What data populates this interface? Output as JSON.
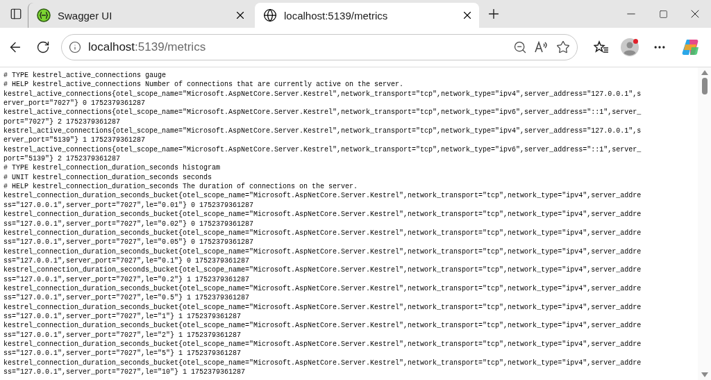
{
  "tabs": [
    {
      "title": "Swagger UI",
      "selected": false
    },
    {
      "title": "localhost:5139/metrics",
      "selected": true
    }
  ],
  "address": {
    "host": "localhost",
    "path": ":5139/metrics"
  },
  "profile": {
    "notification": true
  },
  "lines": [
    "# TYPE kestrel_active_connections gauge",
    "# HELP kestrel_active_connections Number of connections that are currently active on the server.",
    "kestrel_active_connections{otel_scope_name=\"Microsoft.AspNetCore.Server.Kestrel\",network_transport=\"tcp\",network_type=\"ipv4\",server_address=\"127.0.0.1\",s",
    "erver_port=\"7027\"} 0 1752379361287",
    "kestrel_active_connections{otel_scope_name=\"Microsoft.AspNetCore.Server.Kestrel\",network_transport=\"tcp\",network_type=\"ipv6\",server_address=\"::1\",server_",
    "port=\"7027\"} 2 1752379361287",
    "kestrel_active_connections{otel_scope_name=\"Microsoft.AspNetCore.Server.Kestrel\",network_transport=\"tcp\",network_type=\"ipv4\",server_address=\"127.0.0.1\",s",
    "erver_port=\"5139\"} 1 1752379361287",
    "kestrel_active_connections{otel_scope_name=\"Microsoft.AspNetCore.Server.Kestrel\",network_transport=\"tcp\",network_type=\"ipv6\",server_address=\"::1\",server_",
    "port=\"5139\"} 2 1752379361287",
    "# TYPE kestrel_connection_duration_seconds histogram",
    "# UNIT kestrel_connection_duration_seconds seconds",
    "# HELP kestrel_connection_duration_seconds The duration of connections on the server.",
    "kestrel_connection_duration_seconds_bucket{otel_scope_name=\"Microsoft.AspNetCore.Server.Kestrel\",network_transport=\"tcp\",network_type=\"ipv4\",server_addre",
    "ss=\"127.0.0.1\",server_port=\"7027\",le=\"0.01\"} 0 1752379361287",
    "kestrel_connection_duration_seconds_bucket{otel_scope_name=\"Microsoft.AspNetCore.Server.Kestrel\",network_transport=\"tcp\",network_type=\"ipv4\",server_addre",
    "ss=\"127.0.0.1\",server_port=\"7027\",le=\"0.02\"} 0 1752379361287",
    "kestrel_connection_duration_seconds_bucket{otel_scope_name=\"Microsoft.AspNetCore.Server.Kestrel\",network_transport=\"tcp\",network_type=\"ipv4\",server_addre",
    "ss=\"127.0.0.1\",server_port=\"7027\",le=\"0.05\"} 0 1752379361287",
    "kestrel_connection_duration_seconds_bucket{otel_scope_name=\"Microsoft.AspNetCore.Server.Kestrel\",network_transport=\"tcp\",network_type=\"ipv4\",server_addre",
    "ss=\"127.0.0.1\",server_port=\"7027\",le=\"0.1\"} 0 1752379361287",
    "kestrel_connection_duration_seconds_bucket{otel_scope_name=\"Microsoft.AspNetCore.Server.Kestrel\",network_transport=\"tcp\",network_type=\"ipv4\",server_addre",
    "ss=\"127.0.0.1\",server_port=\"7027\",le=\"0.2\"} 1 1752379361287",
    "kestrel_connection_duration_seconds_bucket{otel_scope_name=\"Microsoft.AspNetCore.Server.Kestrel\",network_transport=\"tcp\",network_type=\"ipv4\",server_addre",
    "ss=\"127.0.0.1\",server_port=\"7027\",le=\"0.5\"} 1 1752379361287",
    "kestrel_connection_duration_seconds_bucket{otel_scope_name=\"Microsoft.AspNetCore.Server.Kestrel\",network_transport=\"tcp\",network_type=\"ipv4\",server_addre",
    "ss=\"127.0.0.1\",server_port=\"7027\",le=\"1\"} 1 1752379361287",
    "kestrel_connection_duration_seconds_bucket{otel_scope_name=\"Microsoft.AspNetCore.Server.Kestrel\",network_transport=\"tcp\",network_type=\"ipv4\",server_addre",
    "ss=\"127.0.0.1\",server_port=\"7027\",le=\"2\"} 1 1752379361287",
    "kestrel_connection_duration_seconds_bucket{otel_scope_name=\"Microsoft.AspNetCore.Server.Kestrel\",network_transport=\"tcp\",network_type=\"ipv4\",server_addre",
    "ss=\"127.0.0.1\",server_port=\"7027\",le=\"5\"} 1 1752379361287",
    "kestrel_connection_duration_seconds_bucket{otel_scope_name=\"Microsoft.AspNetCore.Server.Kestrel\",network_transport=\"tcp\",network_type=\"ipv4\",server_addre",
    "ss=\"127.0.0.1\",server_port=\"7027\",le=\"10\"} 1 1752379361287"
  ]
}
